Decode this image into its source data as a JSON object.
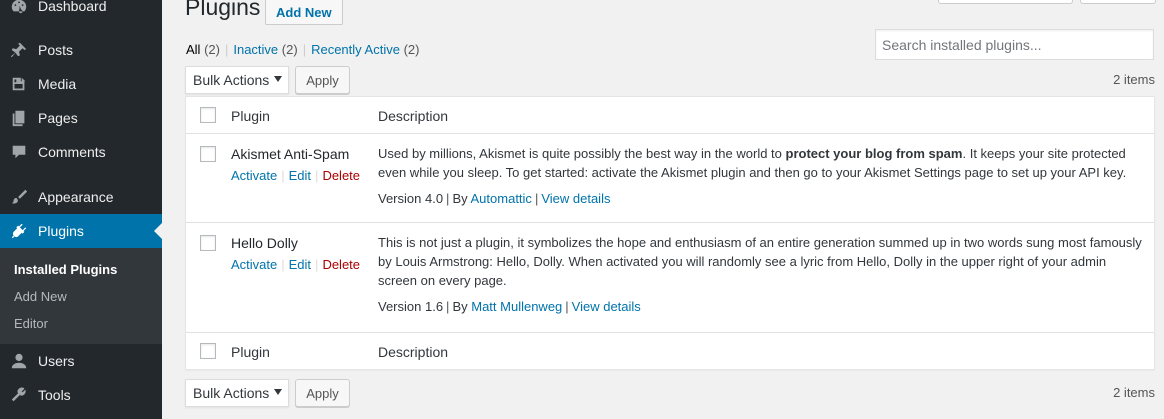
{
  "sidebar": {
    "items": [
      {
        "label": "Dashboard",
        "icon": "dashboard-icon"
      },
      {
        "label": "Posts",
        "icon": "pin-icon"
      },
      {
        "label": "Media",
        "icon": "media-icon"
      },
      {
        "label": "Pages",
        "icon": "pages-icon"
      },
      {
        "label": "Comments",
        "icon": "comment-icon"
      },
      {
        "label": "Appearance",
        "icon": "brush-icon"
      },
      {
        "label": "Plugins",
        "icon": "plugin-icon"
      },
      {
        "label": "Users",
        "icon": "user-icon"
      },
      {
        "label": "Tools",
        "icon": "wrench-icon"
      }
    ],
    "submenu": [
      "Installed Plugins",
      "Add New",
      "Editor"
    ]
  },
  "header": {
    "title": "Plugins",
    "add_new": "Add New"
  },
  "views": {
    "all_label": "All",
    "all_count": "(2)",
    "inactive_label": "Inactive",
    "inactive_count": "(2)",
    "recent_label": "Recently Active",
    "recent_count": "(2)",
    "separator": "|"
  },
  "search": {
    "placeholder": "Search installed plugins..."
  },
  "bulk": {
    "label": "Bulk Actions",
    "apply": "Apply",
    "items_count": "2 items"
  },
  "table": {
    "headers": {
      "plugin": "Plugin",
      "description": "Description"
    },
    "plugins": [
      {
        "name": "Akismet Anti-Spam",
        "actions": {
          "activate": "Activate",
          "edit": "Edit",
          "delete": "Delete"
        },
        "desc_before": "Used by millions, Akismet is quite possibly the best way in the world to ",
        "desc_bold": "protect your blog from spam",
        "desc_after": ". It keeps your site protected even while you sleep. To get started: activate the Akismet plugin and then go to your Akismet Settings page to set up your API key.",
        "version": "Version 4.0",
        "by": "By",
        "author": "Automattic",
        "details": "View details"
      },
      {
        "name": "Hello Dolly",
        "actions": {
          "activate": "Activate",
          "edit": "Edit",
          "delete": "Delete"
        },
        "desc_before": "This is not just a plugin, it symbolizes the hope and enthusiasm of an entire generation summed up in two words sung most famously by Louis Armstrong: Hello, Dolly. When activated you will randomly see a lyric from Hello, Dolly in the upper right of your admin screen on every page.",
        "desc_bold": "",
        "desc_after": "",
        "version": "Version 1.6",
        "by": "By",
        "author": "Matt Mullenweg",
        "details": "View details"
      }
    ]
  },
  "colors": {
    "accent": "#0073aa",
    "sidebar": "#23282d",
    "delete": "#aa0000"
  }
}
